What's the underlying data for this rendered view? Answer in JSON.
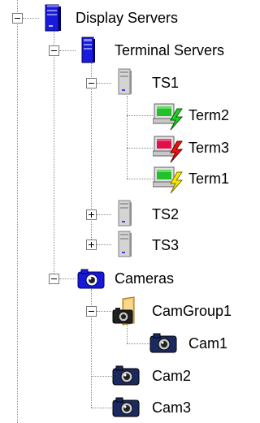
{
  "tree": {
    "display_servers": {
      "label": "Display Servers",
      "expanded": true,
      "icon": "display-server-icon"
    },
    "terminal_servers": {
      "label": "Terminal Servers",
      "expanded": true,
      "icon": "server-tower-icon"
    },
    "ts1": {
      "label": "TS1",
      "expanded": true,
      "icon": "gray-server-icon"
    },
    "term2": {
      "label": "Term2",
      "icon": "terminal-green-icon"
    },
    "term3": {
      "label": "Term3",
      "icon": "terminal-red-icon"
    },
    "term1": {
      "label": "Term1",
      "icon": "terminal-yellow-icon"
    },
    "ts2": {
      "label": "TS2",
      "expanded": false,
      "icon": "gray-server-icon"
    },
    "ts3": {
      "label": "TS3",
      "expanded": false,
      "icon": "gray-server-icon"
    },
    "cameras": {
      "label": "Cameras",
      "expanded": true,
      "icon": "camera-icon"
    },
    "camgroup1": {
      "label": "CamGroup1",
      "expanded": true,
      "icon": "camera-folder-icon"
    },
    "cam1": {
      "label": "Cam1",
      "icon": "camera-icon"
    },
    "cam2": {
      "label": "Cam2",
      "icon": "camera-icon"
    },
    "cam3": {
      "label": "Cam3",
      "icon": "camera-icon"
    }
  },
  "colors": {
    "tree_line": "#8a8a8a",
    "server_blue": "#1a1adc",
    "server_gray": "#c8c8c8",
    "term_green": "#22c02a",
    "term_red": "#e0104a",
    "term_yellow": "#f0e010",
    "lightning_green": "#20d020",
    "lightning_red": "#f01010",
    "lightning_yellow": "#f8e800"
  }
}
